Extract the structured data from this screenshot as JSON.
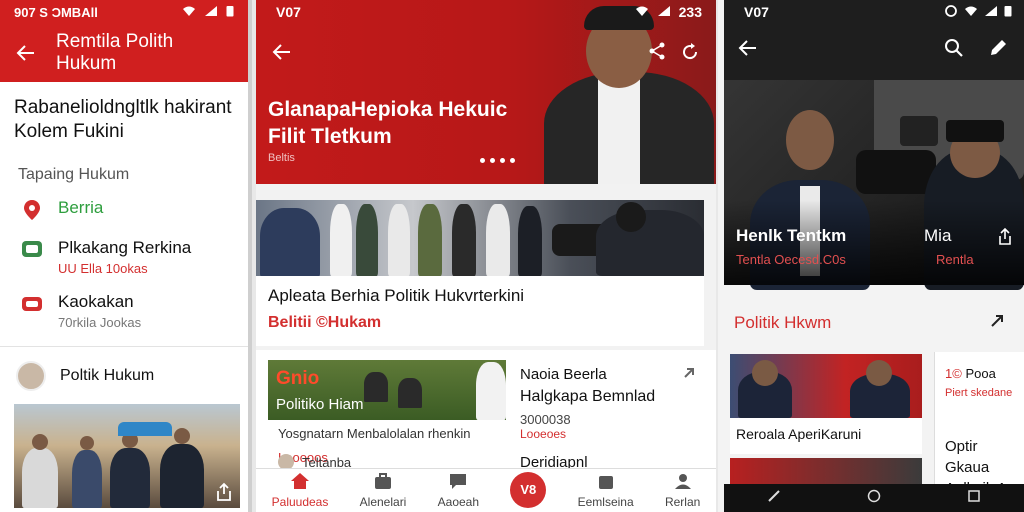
{
  "panel1": {
    "status_left": "907 S ƆMBAll",
    "title": "Remtila Polith Hukum",
    "headline": "Rabanelio­ldngltlk hakirant Kolem Fukini",
    "subhead": "Tapaing Hukum",
    "items": [
      {
        "label": "Berria",
        "sub": "",
        "accent": "#2e9e3e"
      },
      {
        "label": "Plkakang Rerkina",
        "sub": "UU Ella 10okas",
        "accent": "#111111"
      },
      {
        "label": "Kaokakan",
        "sub": "70rkila Jookas",
        "accent": "#111111"
      }
    ],
    "profile_label": "Poltik Hukum",
    "colors": {
      "brand": "#d01f1f"
    }
  },
  "panel2": {
    "status_left": "V07",
    "status_right": "233",
    "hero_title_line1": "Glanapa­Hepioka Hekuic",
    "hero_title_line2": "Filit Tletkum",
    "hero_category": "Beltis",
    "card1_title": "Apleata Berhia Politik Hukvrterkini",
    "card1_category": "Belitii ©Hukam",
    "card2_overlay1": "Gnio",
    "card2_overlay2": "Politiko Hiam",
    "card2_caption": "Yosgnatarn Menbalolalan rhenkin",
    "card2_count": "Looooos",
    "side_title1": "Naoia Beerla",
    "side_title2": "Halgkapa Bemnlad",
    "side_num": "3000038",
    "side_code": "Looeoes",
    "side_bottom": "Deridiapnl",
    "side_author": "Teltanba",
    "nav": [
      {
        "label": "Paluudeas",
        "icon": "home-icon",
        "active": true
      },
      {
        "label": "Alenelari",
        "icon": "briefcase-icon",
        "active": false
      },
      {
        "label": "Aaoeah",
        "icon": "chat-icon",
        "active": false
      },
      {
        "label": "V8",
        "icon": "fab-icon",
        "active": false
      },
      {
        "label": "Eemlseina",
        "icon": "bag-icon",
        "active": false
      },
      {
        "label": "Rerlan",
        "icon": "user-icon",
        "active": false
      }
    ]
  },
  "panel3": {
    "status_left": "V07",
    "hero_title": "Henlk Tentkm",
    "hero_category": "Tentla Oecesd.C0s",
    "hero_meta": "Mia",
    "hero_category2": "Rentla",
    "section_title": "Politik Hkwm",
    "card_a_title": "Reroala AperiKaruni",
    "card_b_a": "Pooa",
    "card_b_b": "Piert skedane",
    "card_b_c1": "Optir Gkaua",
    "card_b_c2": "Anlkaik Aug"
  }
}
